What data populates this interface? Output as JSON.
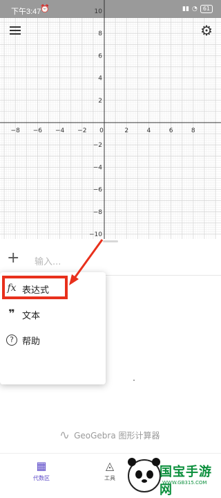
{
  "status_bar": {
    "time": "下午3:47",
    "battery": "61"
  },
  "graph": {
    "x_ticks": [
      "−8",
      "−6",
      "−4",
      "−2",
      "0",
      "2",
      "4",
      "6",
      "8"
    ],
    "y_ticks": [
      "10",
      "8",
      "6",
      "4",
      "2",
      "−2",
      "−4",
      "−6",
      "−8",
      "−10"
    ],
    "grid": true,
    "background": "#ffffff"
  },
  "algebra": {
    "input_placeholder": "输入..."
  },
  "dropdown": {
    "items": [
      {
        "icon": "fx-icon",
        "label": "表达式"
      },
      {
        "icon": "quote-icon",
        "label": "文本"
      },
      {
        "icon": "help-icon",
        "label": "帮助"
      }
    ]
  },
  "branding": {
    "text": "GeoGebra 图形计算器"
  },
  "bottom_nav": {
    "tabs": [
      {
        "icon": "calculator-icon",
        "label": "代数区"
      },
      {
        "icon": "tools-icon",
        "label": "工具"
      }
    ]
  },
  "watermark": {
    "text": "国宝手游网",
    "sub": "WWW.GB315.COM"
  },
  "colors": {
    "accent": "#5b49c8",
    "highlight": "#e8301c",
    "watermark": "#0b8f3c"
  }
}
